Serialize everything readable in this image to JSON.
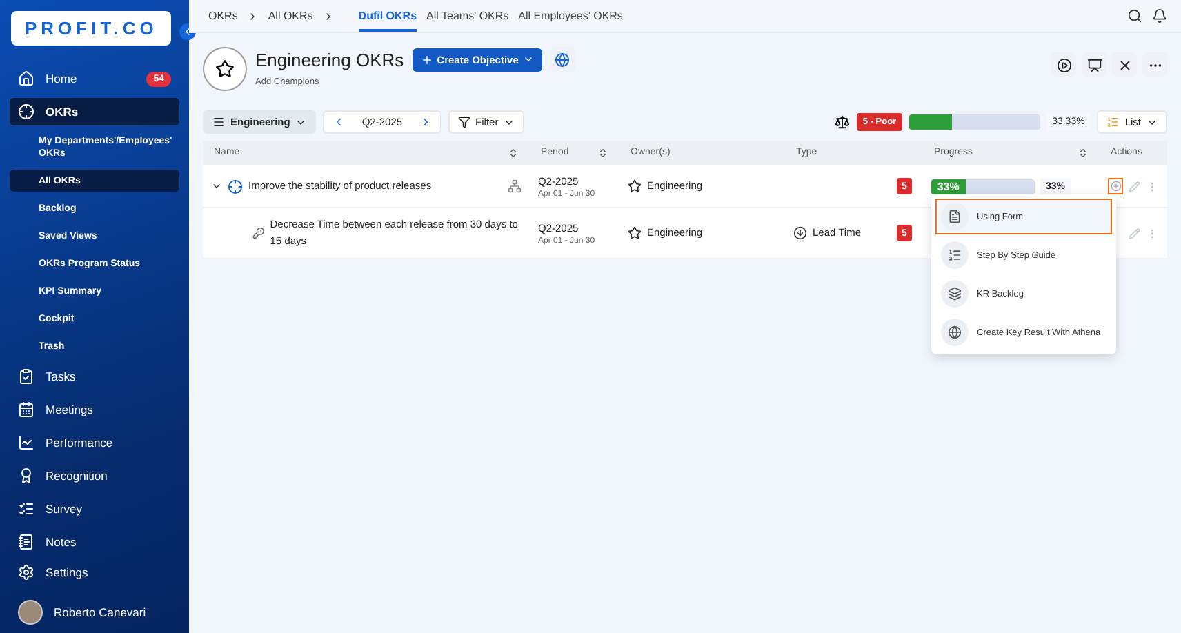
{
  "sidebar": {
    "logo": "PROFIT.CO",
    "items": [
      {
        "kind": "main",
        "label": "Home",
        "badge": "54",
        "selected": false
      },
      {
        "kind": "main",
        "label": "OKRs",
        "selected": true
      },
      {
        "kind": "sub",
        "label": "My Departments'/Employees' OKRs",
        "selected": false
      },
      {
        "kind": "sub",
        "label": "All OKRs",
        "selected": true
      },
      {
        "kind": "sub",
        "label": "Backlog",
        "selected": false
      },
      {
        "kind": "sub",
        "label": "Saved Views",
        "selected": false
      },
      {
        "kind": "sub",
        "label": "OKRs Program Status",
        "selected": false
      },
      {
        "kind": "sub",
        "label": "KPI Summary",
        "selected": false
      },
      {
        "kind": "sub",
        "label": "Cockpit",
        "selected": false
      },
      {
        "kind": "sub",
        "label": "Trash",
        "selected": false
      },
      {
        "kind": "main",
        "label": "Tasks",
        "selected": false
      },
      {
        "kind": "main",
        "label": "Meetings",
        "selected": false
      },
      {
        "kind": "main",
        "label": "Performance",
        "selected": false
      },
      {
        "kind": "main",
        "label": "Recognition",
        "selected": false
      },
      {
        "kind": "main",
        "label": "Survey",
        "selected": false
      },
      {
        "kind": "main",
        "label": "Notes",
        "selected": false
      }
    ],
    "settings": "Settings",
    "user": "Roberto Canevari"
  },
  "breadcrumbs": [
    "OKRs",
    "All OKRs"
  ],
  "tabs": [
    {
      "label": "Dufil OKRs",
      "selected": true
    },
    {
      "label": "All Teams' OKRs",
      "selected": false
    },
    {
      "label": "All Employees' OKRs",
      "selected": false
    }
  ],
  "header": {
    "title": "Engineering OKRs",
    "create_button": "Create Objective",
    "add_champions": "Add Champions"
  },
  "toolbar": {
    "group": "Engineering",
    "period": "Q2-2025",
    "filter": "Filter",
    "score": "5 - Poor",
    "level": 0.33,
    "reading": "33.33%",
    "view": "List"
  },
  "table": {
    "columns": [
      "Name",
      "Period",
      "Owner(s)",
      "Type",
      "Progress",
      "Actions"
    ],
    "rows": [
      {
        "name": "Improve the stability of product releases",
        "expanded": true,
        "period": "Q2-2025",
        "dates": "Apr 01 - Jun 30",
        "owner": "Engineering",
        "score": "5",
        "progress": {
          "label": "33%",
          "level": 0.33,
          "reading": "33%"
        },
        "children": [
          {
            "name": "Decrease Time between each release from 30 days to 15 days",
            "period": "Q2-2025",
            "dates": "Apr 01 - Jun 30",
            "owner": "Engineering",
            "type": "Lead Time",
            "score": "5"
          }
        ]
      }
    ]
  },
  "add_menu": [
    {
      "label": "Using Form",
      "selected": true
    },
    {
      "label": "Step By Step Guide",
      "selected": false
    },
    {
      "label": "KR Backlog",
      "selected": false
    },
    {
      "label": "Create Key Result With Athena",
      "selected": false
    }
  ]
}
